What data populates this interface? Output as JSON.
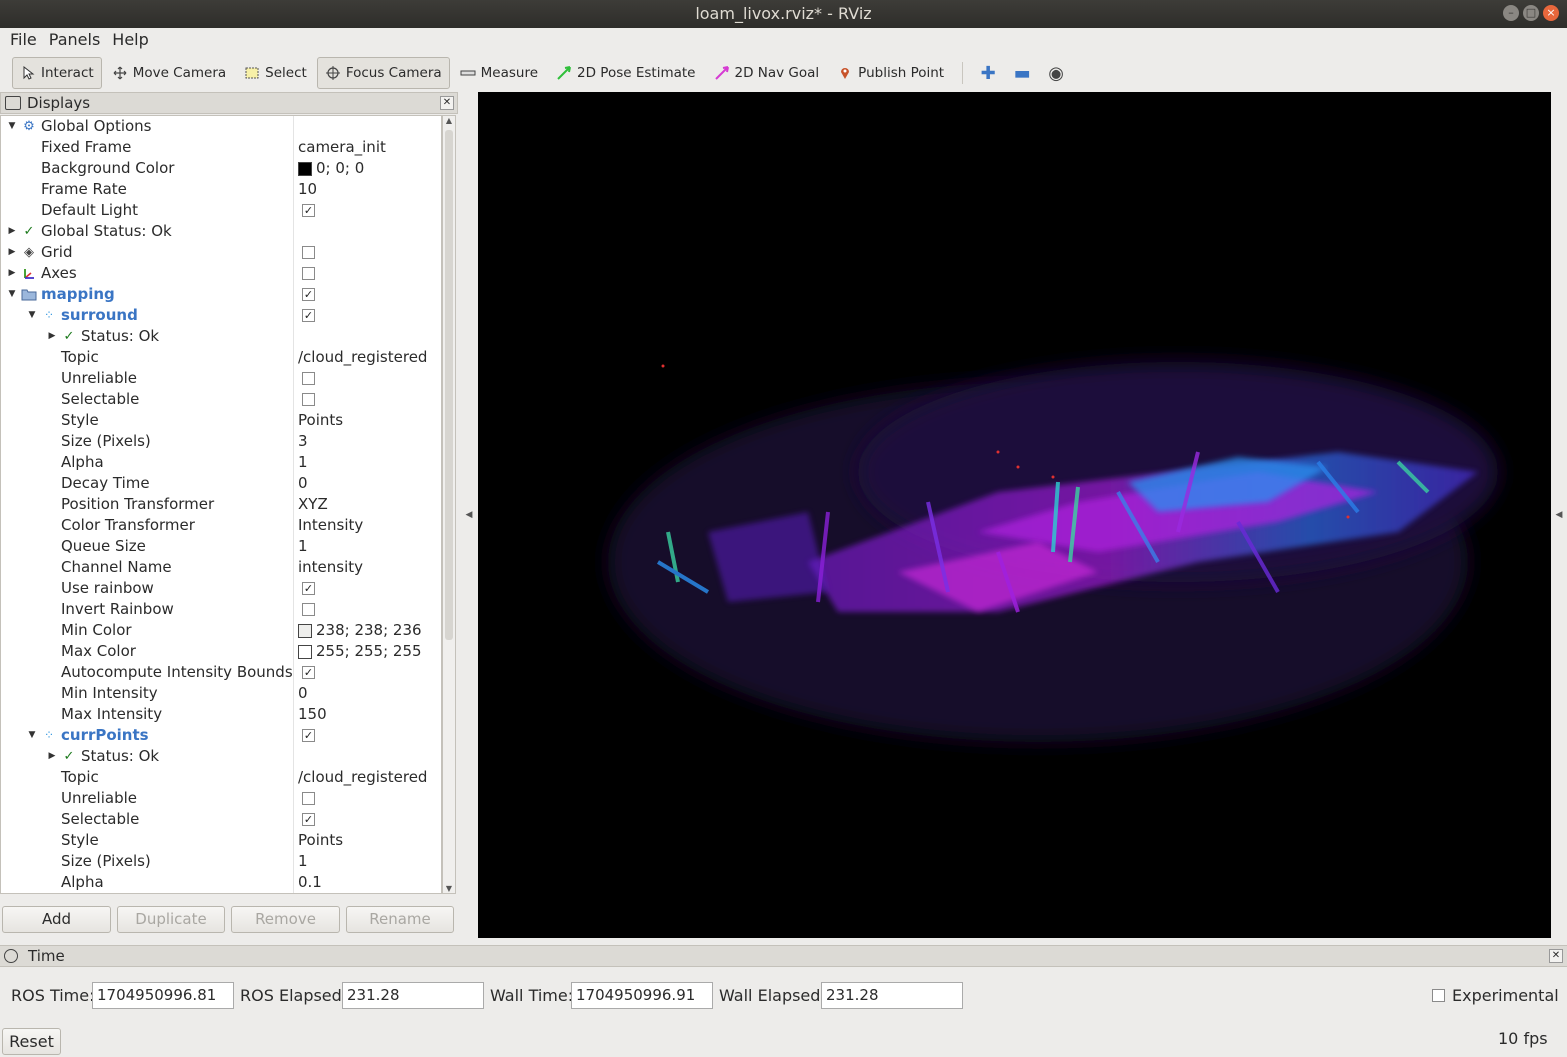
{
  "window": {
    "title": "loam_livox.rviz* - RViz"
  },
  "menubar": {
    "items": [
      "File",
      "Panels",
      "Help"
    ]
  },
  "toolbar": {
    "tools": [
      {
        "label": "Interact",
        "icon": "cursor-icon",
        "active": true
      },
      {
        "label": "Move Camera",
        "icon": "move-camera-icon",
        "active": false
      },
      {
        "label": "Select",
        "icon": "select-box-icon",
        "active": false
      },
      {
        "label": "Focus Camera",
        "icon": "focus-camera-icon",
        "active": true
      },
      {
        "label": "Measure",
        "icon": "ruler-icon",
        "active": false
      },
      {
        "label": "2D Pose Estimate",
        "icon": "green-arrow-icon",
        "active": false
      },
      {
        "label": "2D Nav Goal",
        "icon": "pink-arrow-icon",
        "active": false
      },
      {
        "label": "Publish Point",
        "icon": "map-pin-icon",
        "active": false
      }
    ]
  },
  "displays": {
    "title": "Displays",
    "rows": [
      {
        "indent": 0,
        "arrow": "down",
        "icon": "gear-icon",
        "name": "Global Options",
        "style": "normal",
        "value": ""
      },
      {
        "indent": 1,
        "arrow": "",
        "icon": "",
        "name": "Fixed Frame",
        "value": "camera_init"
      },
      {
        "indent": 1,
        "arrow": "",
        "icon": "",
        "name": "Background Color",
        "value": "0; 0; 0",
        "swatch": "#000000"
      },
      {
        "indent": 1,
        "arrow": "",
        "icon": "",
        "name": "Frame Rate",
        "value": "10"
      },
      {
        "indent": 1,
        "arrow": "",
        "icon": "",
        "name": "Default Light",
        "check": true
      },
      {
        "indent": 0,
        "arrow": "right",
        "icon": "checkmark-icon",
        "name": "Global Status: Ok",
        "value": ""
      },
      {
        "indent": 0,
        "arrow": "right",
        "icon": "grid-icon",
        "name": "Grid",
        "check": false
      },
      {
        "indent": 0,
        "arrow": "right",
        "icon": "axes-icon",
        "name": "Axes",
        "check": false
      },
      {
        "indent": 0,
        "arrow": "down",
        "icon": "folder-icon",
        "name": "mapping",
        "style": "folder",
        "check": true
      },
      {
        "indent": 1,
        "arrow": "down",
        "icon": "pointcloud-icon",
        "name": "surround",
        "style": "folder",
        "check": true
      },
      {
        "indent": 2,
        "arrow": "right",
        "icon": "checkmark-icon",
        "name": "Status: Ok",
        "value": ""
      },
      {
        "indent": 2,
        "arrow": "",
        "icon": "",
        "name": "Topic",
        "value": "/cloud_registered"
      },
      {
        "indent": 2,
        "arrow": "",
        "icon": "",
        "name": "Unreliable",
        "check": false
      },
      {
        "indent": 2,
        "arrow": "",
        "icon": "",
        "name": "Selectable",
        "check": false
      },
      {
        "indent": 2,
        "arrow": "",
        "icon": "",
        "name": "Style",
        "value": "Points"
      },
      {
        "indent": 2,
        "arrow": "",
        "icon": "",
        "name": "Size (Pixels)",
        "value": "3"
      },
      {
        "indent": 2,
        "arrow": "",
        "icon": "",
        "name": "Alpha",
        "value": "1"
      },
      {
        "indent": 2,
        "arrow": "",
        "icon": "",
        "name": "Decay Time",
        "value": "0"
      },
      {
        "indent": 2,
        "arrow": "",
        "icon": "",
        "name": "Position Transformer",
        "value": "XYZ"
      },
      {
        "indent": 2,
        "arrow": "",
        "icon": "",
        "name": "Color Transformer",
        "value": "Intensity"
      },
      {
        "indent": 2,
        "arrow": "",
        "icon": "",
        "name": "Queue Size",
        "value": "1"
      },
      {
        "indent": 2,
        "arrow": "",
        "icon": "",
        "name": "Channel Name",
        "value": "intensity"
      },
      {
        "indent": 2,
        "arrow": "",
        "icon": "",
        "name": "Use rainbow",
        "check": true
      },
      {
        "indent": 2,
        "arrow": "",
        "icon": "",
        "name": "Invert Rainbow",
        "check": false
      },
      {
        "indent": 2,
        "arrow": "",
        "icon": "",
        "name": "Min Color",
        "value": "238; 238; 236",
        "swatch": "#eeeeec"
      },
      {
        "indent": 2,
        "arrow": "",
        "icon": "",
        "name": "Max Color",
        "value": "255; 255; 255",
        "swatch": "#ffffff"
      },
      {
        "indent": 2,
        "arrow": "",
        "icon": "",
        "name": "Autocompute Intensity Bounds",
        "check": true
      },
      {
        "indent": 2,
        "arrow": "",
        "icon": "",
        "name": "Min Intensity",
        "value": "0"
      },
      {
        "indent": 2,
        "arrow": "",
        "icon": "",
        "name": "Max Intensity",
        "value": "150"
      },
      {
        "indent": 1,
        "arrow": "down",
        "icon": "pointcloud-icon",
        "name": "currPoints",
        "style": "folder",
        "check": true
      },
      {
        "indent": 2,
        "arrow": "right",
        "icon": "checkmark-icon",
        "name": "Status: Ok",
        "value": ""
      },
      {
        "indent": 2,
        "arrow": "",
        "icon": "",
        "name": "Topic",
        "value": "/cloud_registered"
      },
      {
        "indent": 2,
        "arrow": "",
        "icon": "",
        "name": "Unreliable",
        "check": false
      },
      {
        "indent": 2,
        "arrow": "",
        "icon": "",
        "name": "Selectable",
        "check": true
      },
      {
        "indent": 2,
        "arrow": "",
        "icon": "",
        "name": "Style",
        "value": "Points"
      },
      {
        "indent": 2,
        "arrow": "",
        "icon": "",
        "name": "Size (Pixels)",
        "value": "1"
      },
      {
        "indent": 2,
        "arrow": "",
        "icon": "",
        "name": "Alpha",
        "value": "0.1"
      }
    ],
    "buttons": {
      "add": "Add",
      "duplicate": "Duplicate",
      "remove": "Remove",
      "rename": "Rename"
    }
  },
  "time": {
    "title": "Time",
    "ros_time_label": "ROS Time:",
    "ros_time": "1704950996.81",
    "ros_elapsed_label": "ROS Elapsed:",
    "ros_elapsed": "231.28",
    "wall_time_label": "Wall Time:",
    "wall_time": "1704950996.91",
    "wall_elapsed_label": "Wall Elapsed:",
    "wall_elapsed": "231.28",
    "experimental_label": "Experimental",
    "reset_label": "Reset",
    "fps": "10 fps"
  },
  "colors": {
    "accent": "#3a75c4",
    "view_background": "#000000"
  }
}
